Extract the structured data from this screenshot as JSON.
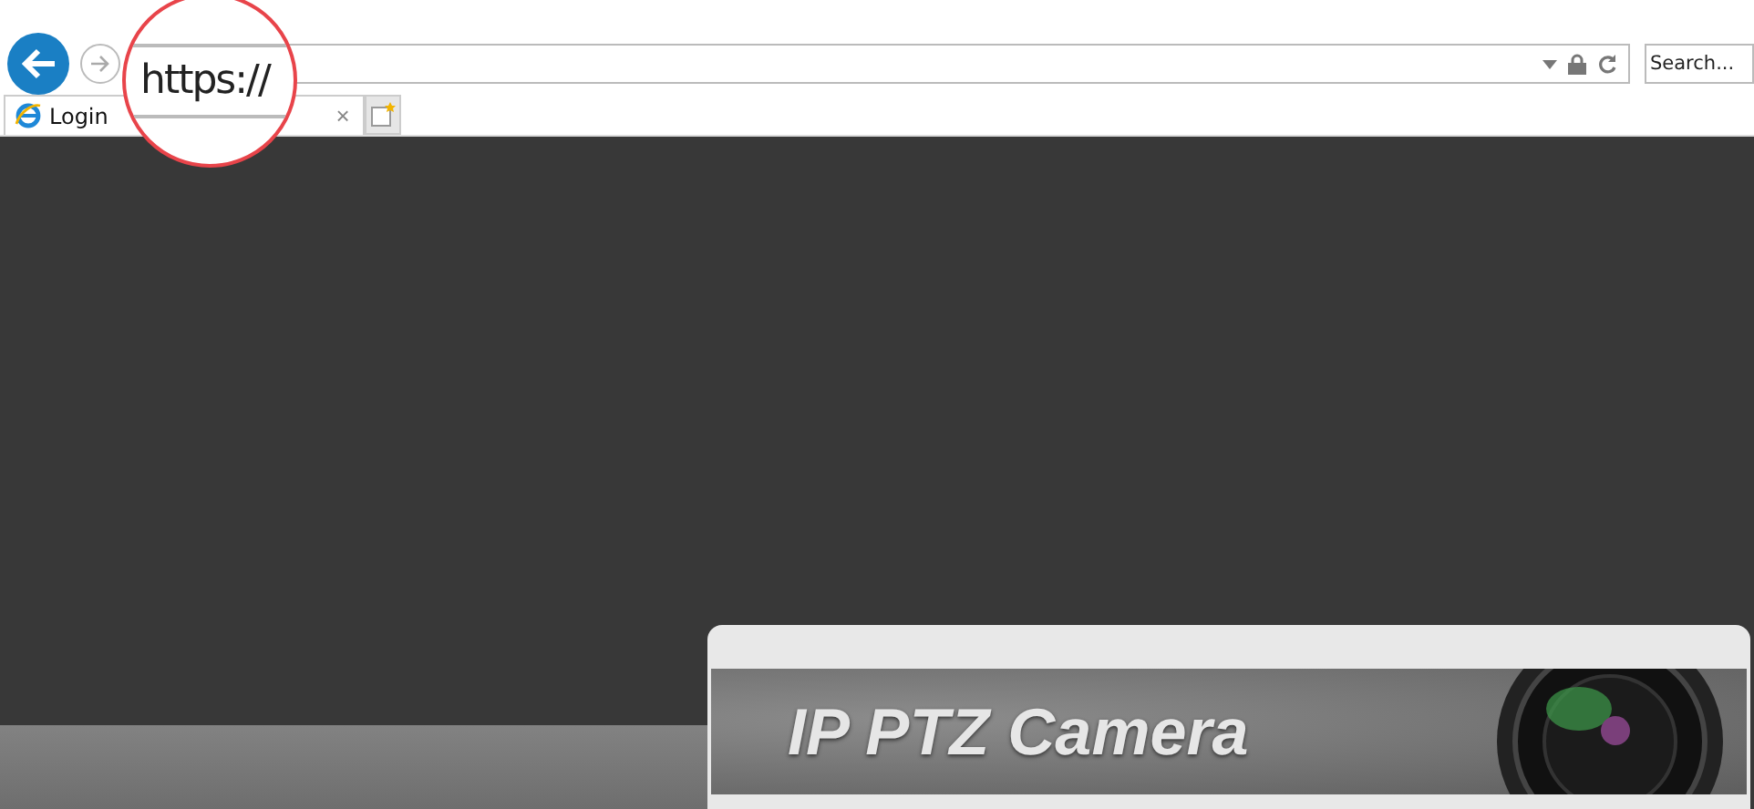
{
  "browser": {
    "search": {
      "placeholder": "Search..."
    },
    "tabs": [
      {
        "label": "Login",
        "selected": true,
        "close": "×"
      }
    ]
  },
  "callout": {
    "text": "https://"
  },
  "login_panel": {
    "title": "IP PTZ Camera"
  }
}
